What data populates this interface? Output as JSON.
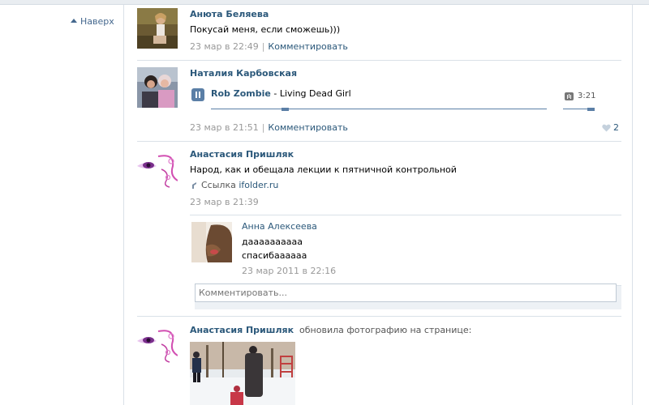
{
  "nav": {
    "back_top": "Наверх"
  },
  "posts": [
    {
      "author": "Анюта Беляева",
      "text": "Покусай меня, если сможешь)))",
      "date": "23 мар в 22:49",
      "comment_link": "Комментировать"
    },
    {
      "author": "Наталия Карбовская",
      "audio": {
        "artist": "Rob Zombie",
        "separator": " - ",
        "title": "Living Dead Girl",
        "duration": "3:21",
        "progress": 0.22
      },
      "date": "23 мар в 21:51",
      "comment_link": "Комментировать",
      "likes": "2"
    },
    {
      "author": "Анастасия Пришляк",
      "text": "Народ, как и обещала лекции к пятничной контрольной",
      "link_prefix": "Ссылка",
      "link_domain": "ifolder.ru",
      "date": "23 мар в 21:39",
      "comment": {
        "author": "Анна Алексеева",
        "line1": "даааааааааа",
        "line2": "спасибаааааа",
        "date": "23 мар 2011 в 22:16"
      },
      "comment_placeholder": "Комментировать..."
    },
    {
      "author": "Анастасия Пришляк",
      "action": "обновила фотографию на странице:"
    }
  ],
  "colors": {
    "link": "#2b587a",
    "meta": "#999999",
    "accent": "#5b7fa6",
    "divider": "#dae1e8"
  }
}
